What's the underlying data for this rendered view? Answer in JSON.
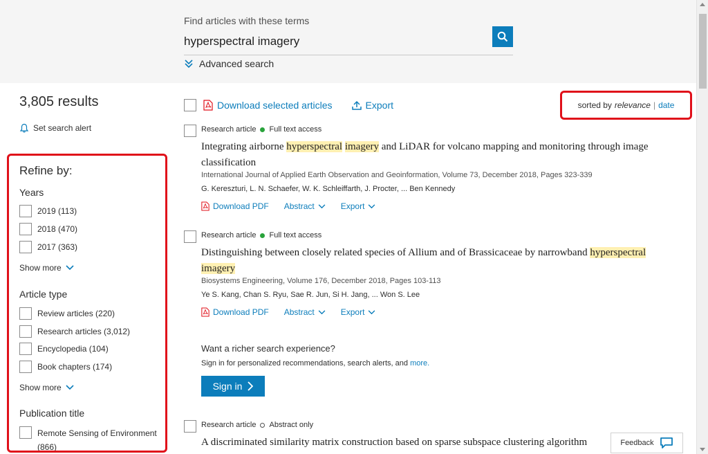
{
  "search": {
    "label": "Find articles with these terms",
    "query": "hyperspectral imagery",
    "advanced": "Advanced search"
  },
  "results": {
    "count": "3,805 results",
    "alert": "Set search alert"
  },
  "refine": {
    "title": "Refine by:",
    "years": {
      "title": "Years",
      "items": [
        {
          "label": "2019 (113)"
        },
        {
          "label": "2018 (470)"
        },
        {
          "label": "2017 (363)"
        }
      ],
      "show_more": "Show more"
    },
    "article_type": {
      "title": "Article type",
      "items": [
        {
          "label": "Review articles (220)"
        },
        {
          "label": "Research articles (3,012)"
        },
        {
          "label": "Encyclopedia (104)"
        },
        {
          "label": "Book chapters (174)"
        }
      ],
      "show_more": "Show more"
    },
    "publication": {
      "title": "Publication title",
      "items": [
        {
          "label": "Remote Sensing of Environment",
          "count": "(866)"
        }
      ]
    }
  },
  "toolbar": {
    "download": "Download selected articles",
    "export": "Export",
    "sorted_by": "sorted by",
    "relevance": "relevance",
    "separator": "|",
    "date": "date"
  },
  "articles": [
    {
      "type": "Research article",
      "access": "Full text access",
      "title_parts": [
        "Integrating airborne ",
        "hyperspectral",
        " ",
        "imagery",
        " and LiDAR for volcano mapping and monitoring through image classification"
      ],
      "journal": "International Journal of Applied Earth Observation and Geoinformation, Volume 73, December 2018, Pages 323-339",
      "authors": "G. Kereszturi, L. N. Schaefer, W. K. Schleiffarth, J. Procter, ... Ben Kennedy",
      "download": "Download PDF",
      "abstract": "Abstract",
      "export": "Export"
    },
    {
      "type": "Research article",
      "access": "Full text access",
      "title_parts": [
        "Distinguishing between closely related species of Allium and of Brassicaceae by narrowband ",
        "hyperspectral",
        " ",
        "imagery",
        ""
      ],
      "journal": "Biosystems Engineering, Volume 176, December 2018, Pages 103-113",
      "authors": "Ye S. Kang, Chan S. Ryu, Sae R. Jun, Si H. Jang, ... Won S. Lee",
      "download": "Download PDF",
      "abstract": "Abstract",
      "export": "Export"
    },
    {
      "type": "Research article",
      "access": "Abstract only",
      "title": "A discriminated similarity matrix construction based on sparse subspace clustering algorithm"
    }
  ],
  "promo": {
    "title": "Want a richer search experience?",
    "text": "Sign in for personalized recommendations, search alerts, and",
    "more": "more.",
    "signin": "Sign in"
  },
  "feedback": "Feedback",
  "colors": {
    "accent": "#0c7dbb",
    "highlight_box": "#e0101a",
    "term_highlight": "#fff0b2",
    "full_text_dot": "#29a33b"
  }
}
